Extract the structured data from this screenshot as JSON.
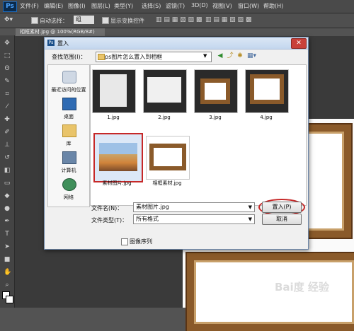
{
  "app": {
    "logo": "Ps"
  },
  "menu": [
    "文件(F)",
    "编辑(E)",
    "图像(I)",
    "图层(L)",
    "类型(Y)",
    "选择(S)",
    "滤镜(T)",
    "3D(D)",
    "视图(V)",
    "窗口(W)",
    "帮助(H)"
  ],
  "options_bar": {
    "auto_select_label": "自动选择：",
    "auto_select_value": "组",
    "show_transform_label": "显示变换控件"
  },
  "document_tab": {
    "title": "相框素材.jpg @ 100%(RGB/8#)"
  },
  "dialog": {
    "title": "置入",
    "look_in_label": "查找范围(I)：",
    "look_in_value": "ps图片怎么置入到相框",
    "places": [
      "最近访问的位置",
      "桌面",
      "库",
      "计算机",
      "网络"
    ],
    "files": [
      {
        "name": "1.jpg"
      },
      {
        "name": "2.jpg"
      },
      {
        "name": "3.jpg"
      },
      {
        "name": "4.jpg"
      },
      {
        "name": "素材图片.jpg"
      },
      {
        "name": "相框素材.jpg"
      }
    ],
    "file_name_label": "文件名(N)：",
    "file_name_value": "素材图片.jpg",
    "file_type_label": "文件类型(T)：",
    "file_type_value": "所有格式",
    "place_button": "置入(P)",
    "cancel_button": "取消",
    "image_sequence_label": "图像序列"
  },
  "watermark": "Bai度 经验",
  "colors": {
    "selection": "#c62828",
    "frame_wood": "#8a5a2a"
  }
}
